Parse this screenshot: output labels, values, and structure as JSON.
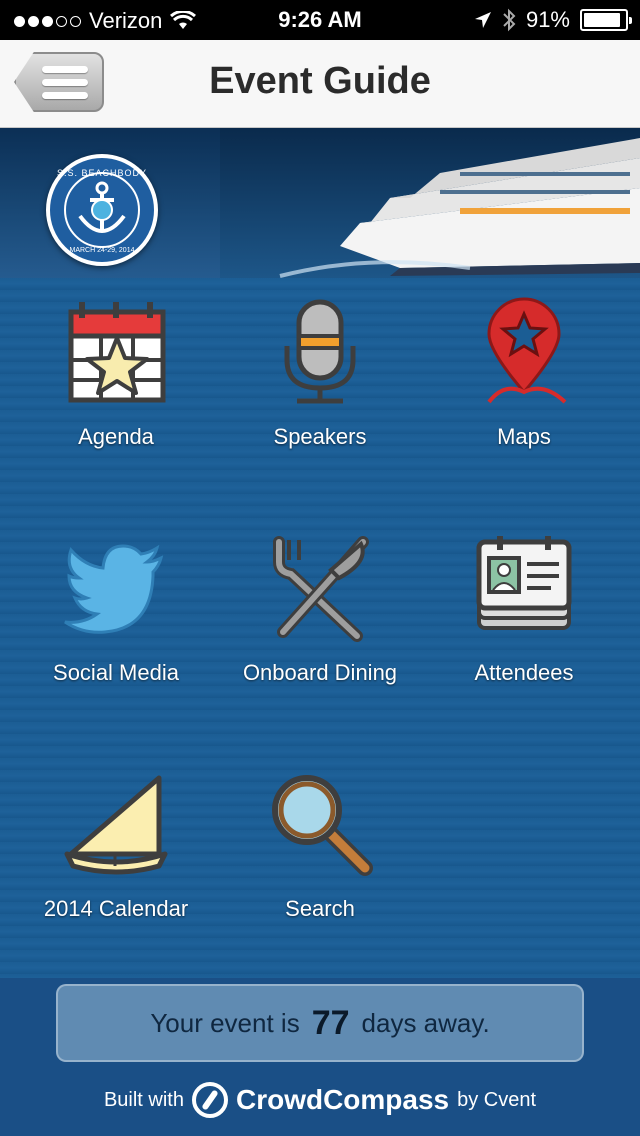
{
  "status_bar": {
    "carrier": "Verizon",
    "time": "9:26 AM",
    "battery": "91%",
    "battery_level": 0.91,
    "icons": [
      "signal-dots-icon",
      "wifi-icon",
      "location-arrow-icon",
      "bluetooth-icon",
      "battery-icon"
    ]
  },
  "nav": {
    "title": "Event Guide",
    "menu_icon": "hamburger-menu-icon"
  },
  "banner": {
    "logo_top_text": "S.S. BEACHBODY",
    "logo_bottom_text": "MARCH 24-29, 2014"
  },
  "menu": {
    "items": [
      {
        "label": "Agenda",
        "icon": "calendar-star-icon"
      },
      {
        "label": "Speakers",
        "icon": "microphone-icon"
      },
      {
        "label": "Maps",
        "icon": "map-pin-icon"
      },
      {
        "label": "Social Media",
        "icon": "twitter-bird-icon"
      },
      {
        "label": "Onboard Dining",
        "icon": "fork-knife-icon"
      },
      {
        "label": "Attendees",
        "icon": "attendee-card-icon"
      },
      {
        "label": "2014 Calendar",
        "icon": "sail-icon"
      },
      {
        "label": "Search",
        "icon": "magnifier-icon"
      }
    ]
  },
  "countdown": {
    "prefix": "Your event is",
    "days": "77",
    "suffix": "days away."
  },
  "footer": {
    "built_with": "Built with",
    "brand": "CrowdCompass",
    "by": "by Cvent"
  },
  "colors": {
    "nav_bg": "#f7f7f7",
    "ocean": "#1b5d94",
    "agenda_red": "#e53b3b",
    "map_red": "#d62b2b",
    "twitter_blue": "#5ab4e5",
    "mic_orange": "#f2a02d",
    "icon_dark": "#3e3e3e",
    "sail_cream": "#fbeeb0"
  }
}
